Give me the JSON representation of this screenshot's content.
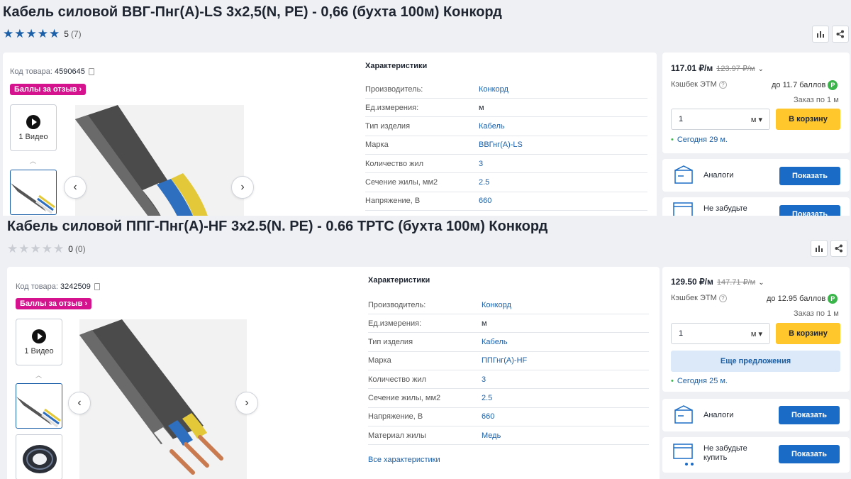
{
  "colors": {
    "accent": "#1a5fa8",
    "badge": "#d5138f",
    "cart": "#ffc72c",
    "cashback": "#3ab54a"
  },
  "product1": {
    "title": "Кабель силовой ВВГ-Пнг(А)-LS 3х2,5(N, PE) - 0,66 (бухта 100м) Конкорд",
    "rating": {
      "value": "5",
      "count": "(7)",
      "stars_filled": 5
    },
    "code_label": "Код товара:",
    "code": "4590645",
    "badge": "Баллы за отзыв ›",
    "video_label": "1 Видео",
    "characteristics_title": "Характеристики",
    "characteristics": [
      {
        "key": "Производитель:",
        "value": "Конкорд"
      },
      {
        "key": "Ед.измерения:",
        "value": "м"
      },
      {
        "key": "Тип изделия",
        "value": "Кабель"
      },
      {
        "key": "Марка",
        "value": "ВВГнг(А)-LS"
      },
      {
        "key": "Количество жил",
        "value": "3"
      },
      {
        "key": "Сечение жилы, мм2",
        "value": "2.5"
      },
      {
        "key": "Напряжение, В",
        "value": "660"
      }
    ],
    "price": "117.01 ₽/м",
    "old_price": "123.97 ₽/м",
    "cashback_label": "Кэшбек ЭТМ",
    "points": "до 11.7 баллов",
    "order_note": "Заказ по 1 м",
    "qty_value": "1",
    "qty_unit": "м",
    "cart_label": "В корзину",
    "delivery": "Сегодня 29 м.",
    "analogs_label": "Аналоги",
    "analogs_button": "Показать",
    "remember_label": "Не забудьте",
    "remember_button": "Показать"
  },
  "product2": {
    "title": "Кабель силовой ППГ-Пнг(А)-HF 3х2.5(N. PE) - 0.66 ТРТС (бухта 100м) Конкорд",
    "rating": {
      "value": "0",
      "count": "(0)",
      "stars_filled": 0
    },
    "code_label": "Код товара:",
    "code": "3242509",
    "badge": "Баллы за отзыв ›",
    "video_label": "1 Видео",
    "characteristics_title": "Характеристики",
    "characteristics": [
      {
        "key": "Производитель:",
        "value": "Конкорд"
      },
      {
        "key": "Ед.измерения:",
        "value": "м"
      },
      {
        "key": "Тип изделия",
        "value": "Кабель"
      },
      {
        "key": "Марка",
        "value": "ППГнг(А)-HF"
      },
      {
        "key": "Количество жил",
        "value": "3"
      },
      {
        "key": "Сечение жилы, мм2",
        "value": "2.5"
      },
      {
        "key": "Напряжение, В",
        "value": "660"
      },
      {
        "key": "Материал жилы",
        "value": "Медь"
      }
    ],
    "all_characteristics": "Все характеристики",
    "price": "129.50 ₽/м",
    "old_price": "147.71 ₽/м",
    "cashback_label": "Кэшбек ЭТМ",
    "points": "до 12.95 баллов",
    "order_note": "Заказ по 1 м",
    "qty_value": "1",
    "qty_unit": "м",
    "cart_label": "В корзину",
    "more_offers": "Еще предложения",
    "delivery": "Сегодня 25 м.",
    "analogs_label": "Аналоги",
    "analogs_button": "Показать",
    "remember_label": "Не забудьте купить",
    "remember_button": "Показать"
  }
}
